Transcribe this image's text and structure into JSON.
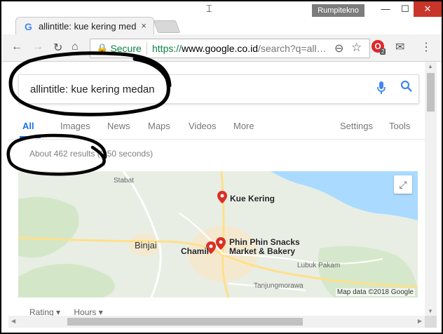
{
  "window": {
    "profile_name": "Rumpitekno",
    "minimize": "—",
    "maximize": "☐",
    "close": "✕"
  },
  "tab": {
    "icon": "G",
    "title": "allintitle: kue kering med",
    "close": "×"
  },
  "toolbar": {
    "back": "←",
    "forward": "→",
    "reload": "↻",
    "home": "⌂",
    "secure_label": "Secure",
    "url_scheme": "https://",
    "url_host": "www.google.co.id",
    "url_rest": "/search?q=all…",
    "extension_badge": "2"
  },
  "search": {
    "query": "allintitle: kue kering medan"
  },
  "tabs": [
    "All",
    "Images",
    "News",
    "Maps",
    "Videos",
    "More"
  ],
  "tools": {
    "settings": "Settings",
    "tools": "Tools"
  },
  "stats": "About 462 results (0.50 seconds)",
  "map": {
    "places": {
      "kue_kering": "Kue Kering",
      "phin_phin_1": "Phin Phin Snacks",
      "phin_phin_2": "Market & Bakery",
      "chamil": "Chamil"
    },
    "towns": {
      "binjai": "Binjai",
      "stabat": "Stabat",
      "lubuk_pakam": "Lubuk Pakam",
      "tanjungmorawa": "Tanjungmorawa"
    },
    "attribution": "Map data ©2018 Google",
    "colors": {
      "land": "#e8eee4",
      "sea": "#aadaff",
      "green": "#cde5c0",
      "urban": "#f4e9cf",
      "pin": "#d93025"
    }
  },
  "filters": {
    "rating": "Rating ▾",
    "hours": "Hours ▾"
  },
  "colors": {
    "accent": "#1a73e8",
    "secure": "#0b8043",
    "close_button": "#c9342b"
  }
}
